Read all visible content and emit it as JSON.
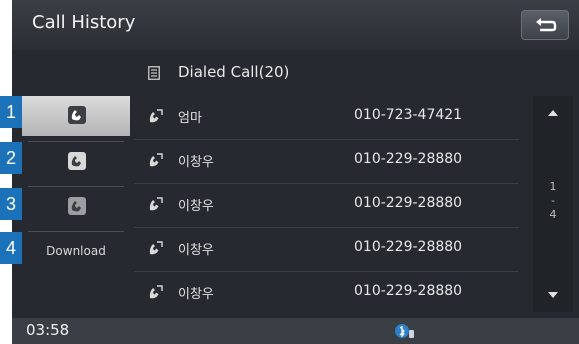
{
  "header": {
    "title": "Call History",
    "back_icon": "return-arrow-icon"
  },
  "subheader": {
    "label": "Dialed Call(20)",
    "icon": "document-list-icon"
  },
  "sidebar": {
    "items": [
      {
        "number": "1",
        "icon": "dialed-call-icon",
        "active": true
      },
      {
        "number": "2",
        "icon": "received-call-icon",
        "active": false
      },
      {
        "number": "3",
        "icon": "missed-call-icon",
        "active": false
      },
      {
        "number": "4",
        "label": "Download",
        "active": false
      }
    ]
  },
  "calls": [
    {
      "name": "엄마",
      "phone": "010-723-47421",
      "icon": "outgoing-call-icon"
    },
    {
      "name": "이창우",
      "phone": "010-229-28880",
      "icon": "outgoing-call-icon"
    },
    {
      "name": "이창우",
      "phone": "010-229-28880",
      "icon": "outgoing-call-icon"
    },
    {
      "name": "이창우",
      "phone": "010-229-28880",
      "icon": "outgoing-call-icon"
    },
    {
      "name": "이창우",
      "phone": "010-229-28880",
      "icon": "outgoing-call-icon"
    }
  ],
  "scroll": {
    "page_current": "1",
    "page_total": "4"
  },
  "status": {
    "time": "03:58",
    "icon": "bluetooth-phone-icon"
  },
  "colors": {
    "badge": "#1c72b8",
    "background": "#26292f"
  }
}
